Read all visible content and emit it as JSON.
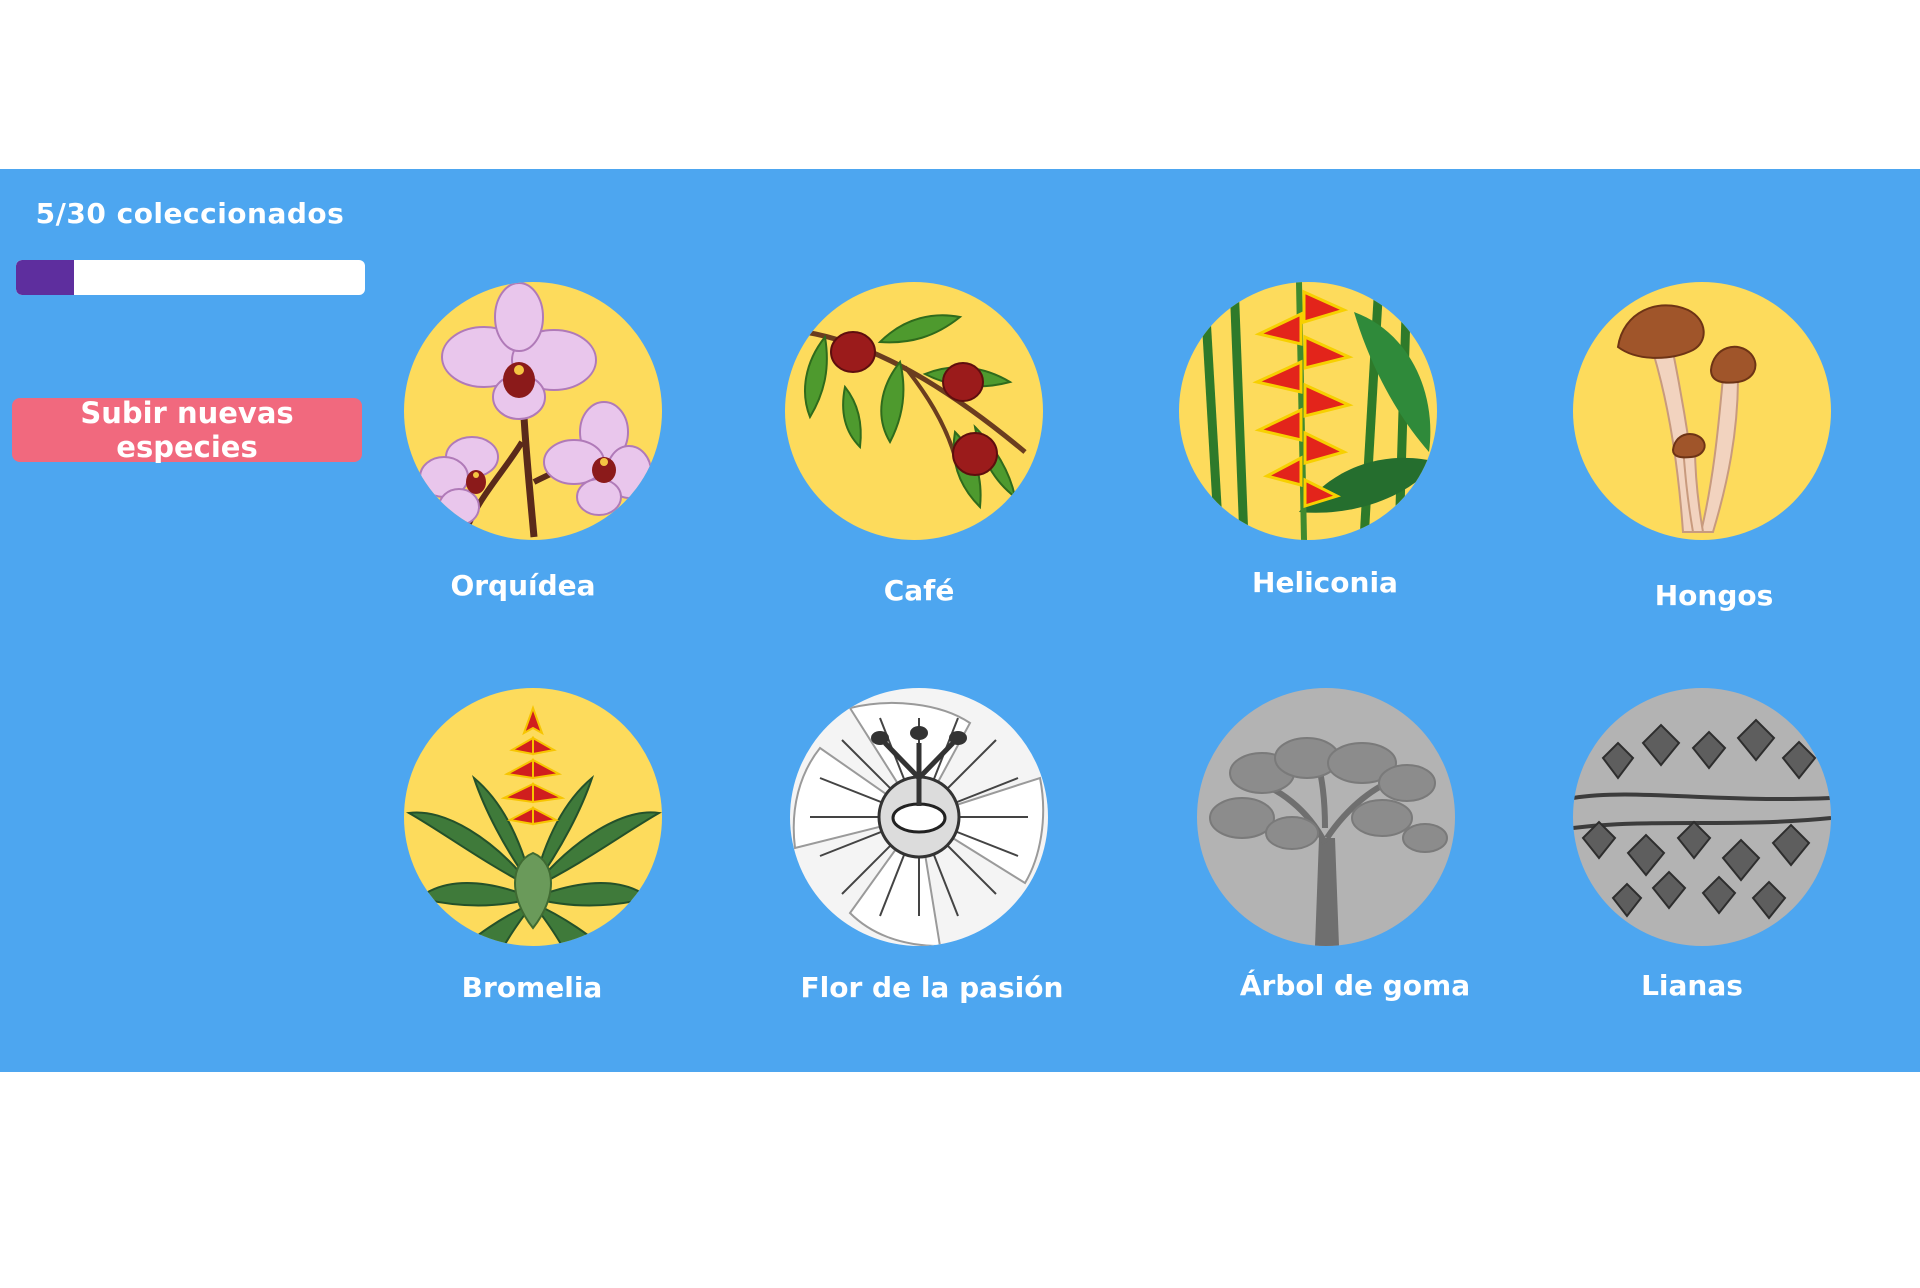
{
  "progress": {
    "label": "5/30 coleccionados",
    "collected": 5,
    "total": 30,
    "fill_color": "#5e2e9e"
  },
  "upload_button": {
    "label": "Subir nuevas especies",
    "color": "#f1697e"
  },
  "colors": {
    "panel": "#4da6f0",
    "circle_unlocked": "#fddb5c",
    "circle_locked": "#b3b3b3"
  },
  "species": [
    {
      "name": "Orquídea",
      "unlocked": true,
      "icon": "orchid-icon"
    },
    {
      "name": "Café",
      "unlocked": true,
      "icon": "coffee-icon"
    },
    {
      "name": "Heliconia",
      "unlocked": true,
      "icon": "heliconia-icon"
    },
    {
      "name": "Hongos",
      "unlocked": true,
      "icon": "mushroom-icon"
    },
    {
      "name": "Bromelia",
      "unlocked": true,
      "icon": "bromeliad-icon"
    },
    {
      "name": "Flor de la pasión",
      "unlocked": false,
      "icon": "passion-flower-icon"
    },
    {
      "name": "Árbol de goma",
      "unlocked": false,
      "icon": "rubber-tree-icon"
    },
    {
      "name": "Lianas",
      "unlocked": false,
      "icon": "lianas-icon"
    }
  ]
}
